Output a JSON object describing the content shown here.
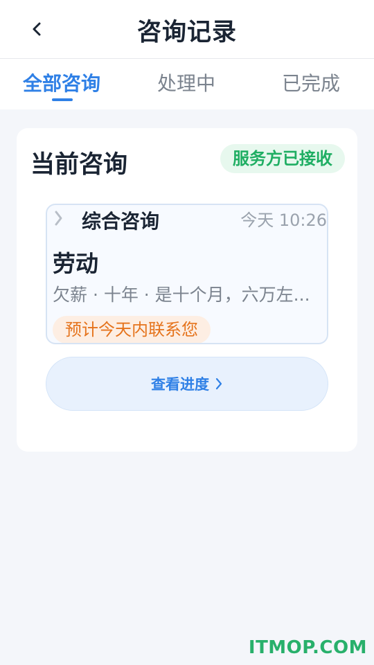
{
  "header": {
    "title": "咨询记录",
    "back_icon": "chevron-left-icon"
  },
  "tabs": [
    {
      "label": "全部咨询",
      "active": true
    },
    {
      "label": "处理中",
      "active": false
    },
    {
      "label": "已完成",
      "active": false
    }
  ],
  "colors": {
    "accent": "#2f80e6",
    "status_green": "#1fae63",
    "tag_orange": "#e5731c"
  },
  "card": {
    "title": "当前咨询",
    "status": "服务方已接收",
    "consult": {
      "type": "综合咨询",
      "time": "今天 10:26",
      "category": "劳动",
      "description": "欠薪 · 十年 · 是十个月，六万左...",
      "tag": "预计今天内联系您"
    },
    "progress_button": "查看进度"
  },
  "watermark": "ITMOP.COM"
}
